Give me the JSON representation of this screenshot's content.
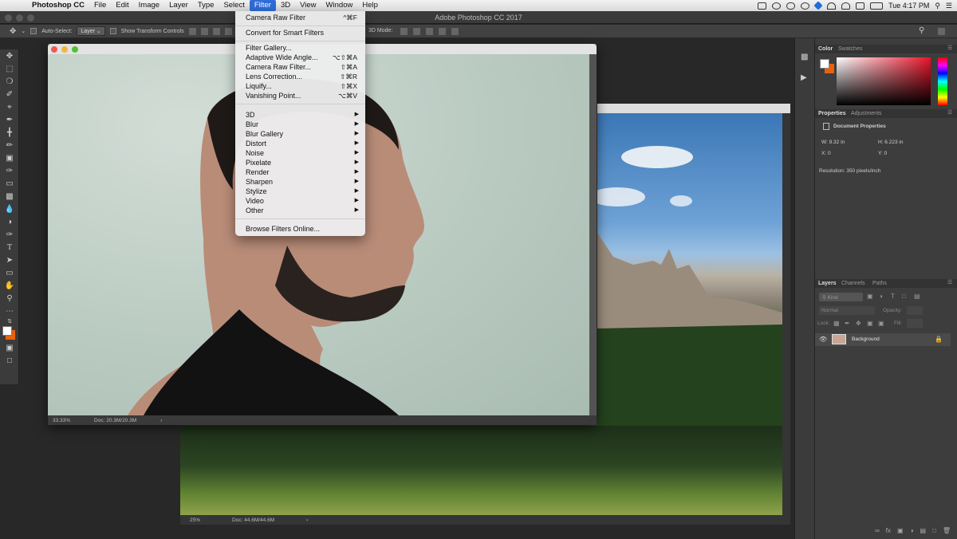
{
  "menubar": {
    "apple": "",
    "app_name": "Photoshop CC",
    "items": [
      "File",
      "Edit",
      "Image",
      "Layer",
      "Type",
      "Select",
      "Filter",
      "3D",
      "View",
      "Window",
      "Help"
    ],
    "active": "Filter",
    "clock": "Tue 4:17 PM"
  },
  "window": {
    "title": "Adobe Photoshop CC 2017"
  },
  "options": {
    "auto_select_label": "Auto-Select:",
    "auto_select_value": "Layer",
    "transform_label": "Show Transform Controls",
    "mode_label": "3D Mode:"
  },
  "filter_menu": {
    "camera_raw_top": {
      "label": "Camera Raw Filter",
      "shortcut": "^⌘F"
    },
    "convert": "Convert for Smart Filters",
    "group1": [
      {
        "label": "Filter Gallery...",
        "shortcut": ""
      },
      {
        "label": "Adaptive Wide Angle...",
        "shortcut": "⌥⇧⌘A"
      },
      {
        "label": "Camera Raw Filter...",
        "shortcut": "⇧⌘A"
      },
      {
        "label": "Lens Correction...",
        "shortcut": "⇧⌘R"
      },
      {
        "label": "Liquify...",
        "shortcut": "⇧⌘X"
      },
      {
        "label": "Vanishing Point...",
        "shortcut": "⌥⌘V"
      }
    ],
    "submenus": [
      "3D",
      "Blur",
      "Blur Gallery",
      "Distort",
      "Noise",
      "Pixelate",
      "Render",
      "Sharpen",
      "Stylize",
      "Video",
      "Other"
    ],
    "browse": "Browse Filters Online..."
  },
  "doc1": {
    "zoom": "33.33%",
    "doc": "Doc: 20.3M/20.3M"
  },
  "doc2": {
    "zoom": "25%",
    "doc": "Doc: 44.6M/44.6M"
  },
  "color_panel": {
    "tab_color": "Color",
    "tab_swatches": "Swatches"
  },
  "properties_panel": {
    "tab_properties": "Properties",
    "tab_adjustments": "Adjustments",
    "title": "Document Properties",
    "w": "W: 9.32 in",
    "h": "H: 6.223 in",
    "x": "X: 0",
    "y": "Y: 0",
    "resolution": "Resolution: 350 pixels/inch"
  },
  "layers_panel": {
    "tab_layers": "Layers",
    "tab_channels": "Channels",
    "tab_paths": "Paths",
    "kind": "Kind",
    "blend": "Normal",
    "opacity": "Opacity:",
    "lock": "Lock:",
    "fill": "Fill:",
    "layer_name": "Background"
  },
  "colors": {
    "menu_highlight": "#2f6cd8",
    "foreground": "#ffffff",
    "background_swatch": "#e8620e"
  }
}
